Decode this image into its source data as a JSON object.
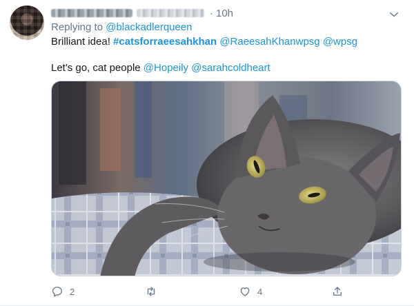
{
  "tweet": {
    "time": "10h",
    "replying_prefix": "Replying to ",
    "replying_to": "@blackadlerqueen",
    "line1_start": "Brilliant idea! ",
    "hashtag": "#catsforraeesahkhan",
    "mention1": "@RaeesahKhanwpsg",
    "mention2": "@wpsg",
    "line2_start": "Let's go, cat people ",
    "mention3": "@Hopeily",
    "mention4": "@sarahcoldheart",
    "reply_count": "2",
    "retweet_count": "",
    "like_count": "4"
  },
  "colors": {
    "link": "#1b95e0",
    "muted": "#657786",
    "text": "#14171a"
  },
  "icons": [
    "chevron-down-icon",
    "reply-icon",
    "retweet-icon",
    "like-icon",
    "share-icon"
  ]
}
